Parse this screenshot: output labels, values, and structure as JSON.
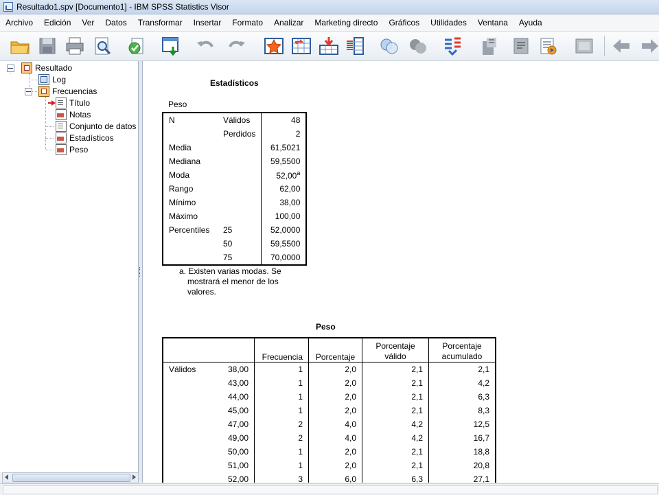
{
  "window": {
    "title": "Resultado1.spv [Documento1] - IBM SPSS Statistics Visor"
  },
  "menu": [
    "Archivo",
    "Edición",
    "Ver",
    "Datos",
    "Transformar",
    "Insertar",
    "Formato",
    "Analizar",
    "Marketing directo",
    "Gráficos",
    "Utilidades",
    "Ventana",
    "Ayuda"
  ],
  "toolbar_icons": [
    "open-folder-icon",
    "save-icon",
    "print-icon",
    "print-preview-icon",
    "export-icon",
    "goto-data-icon",
    "undo-icon",
    "redo-icon",
    "goto-case-icon",
    "goto-variable-icon",
    "insert-cases-icon",
    "variables-icon",
    "show-all-icon",
    "hide-icon",
    "select-cases-icon",
    "designate-window-icon",
    "promote-icon",
    "demote-icon",
    "script-icon",
    "collapse-icon",
    "back-icon",
    "forward-icon"
  ],
  "tree": {
    "root": "Resultado",
    "log": "Log",
    "group": "Frecuencias",
    "items": [
      "Título",
      "Notas",
      "Conjunto de datos",
      "Estadísticos",
      "Peso"
    ]
  },
  "stats": {
    "title": "Estadísticos",
    "variable": "Peso",
    "rows": [
      {
        "label": "N",
        "sub": "Válidos",
        "value": "48"
      },
      {
        "label": "",
        "sub": "Perdidos",
        "value": "2"
      },
      {
        "label": "Media",
        "sub": "",
        "value": "61,5021"
      },
      {
        "label": "Mediana",
        "sub": "",
        "value": "59,5500"
      },
      {
        "label": "Moda",
        "sub": "",
        "value": "52,00",
        "sup": "a"
      },
      {
        "label": "Rango",
        "sub": "",
        "value": "62,00"
      },
      {
        "label": "Mínimo",
        "sub": "",
        "value": "38,00"
      },
      {
        "label": "Máximo",
        "sub": "",
        "value": "100,00"
      },
      {
        "label": "Percentiles",
        "sub": "25",
        "value": "52,0000"
      },
      {
        "label": "",
        "sub": "50",
        "value": "59,5500"
      },
      {
        "label": "",
        "sub": "75",
        "value": "70,0000"
      }
    ],
    "footnote": [
      "a. Existen varias modas. Se",
      "mostrará el menor de los",
      "valores."
    ]
  },
  "freq": {
    "title": "Peso",
    "headers": {
      "frecuencia": "Frecuencia",
      "porcentaje": "Porcentaje",
      "valido_1": "Porcentaje",
      "valido_2": "válido",
      "acum_1": "Porcentaje",
      "acum_2": "acumulado"
    },
    "group_label": "Válidos",
    "rows": [
      {
        "v": "38,00",
        "f": "1",
        "p": "2,0",
        "pv": "2,1",
        "pa": "2,1"
      },
      {
        "v": "43,00",
        "f": "1",
        "p": "2,0",
        "pv": "2,1",
        "pa": "4,2"
      },
      {
        "v": "44,00",
        "f": "1",
        "p": "2,0",
        "pv": "2,1",
        "pa": "6,3"
      },
      {
        "v": "45,00",
        "f": "1",
        "p": "2,0",
        "pv": "2,1",
        "pa": "8,3"
      },
      {
        "v": "47,00",
        "f": "2",
        "p": "4,0",
        "pv": "4,2",
        "pa": "12,5"
      },
      {
        "v": "49,00",
        "f": "2",
        "p": "4,0",
        "pv": "4,2",
        "pa": "16,7"
      },
      {
        "v": "50,00",
        "f": "1",
        "p": "2,0",
        "pv": "2,1",
        "pa": "18,8"
      },
      {
        "v": "51,00",
        "f": "1",
        "p": "2,0",
        "pv": "2,1",
        "pa": "20,8"
      },
      {
        "v": "52,00",
        "f": "3",
        "p": "6,0",
        "pv": "6,3",
        "pa": "27,1"
      }
    ]
  }
}
